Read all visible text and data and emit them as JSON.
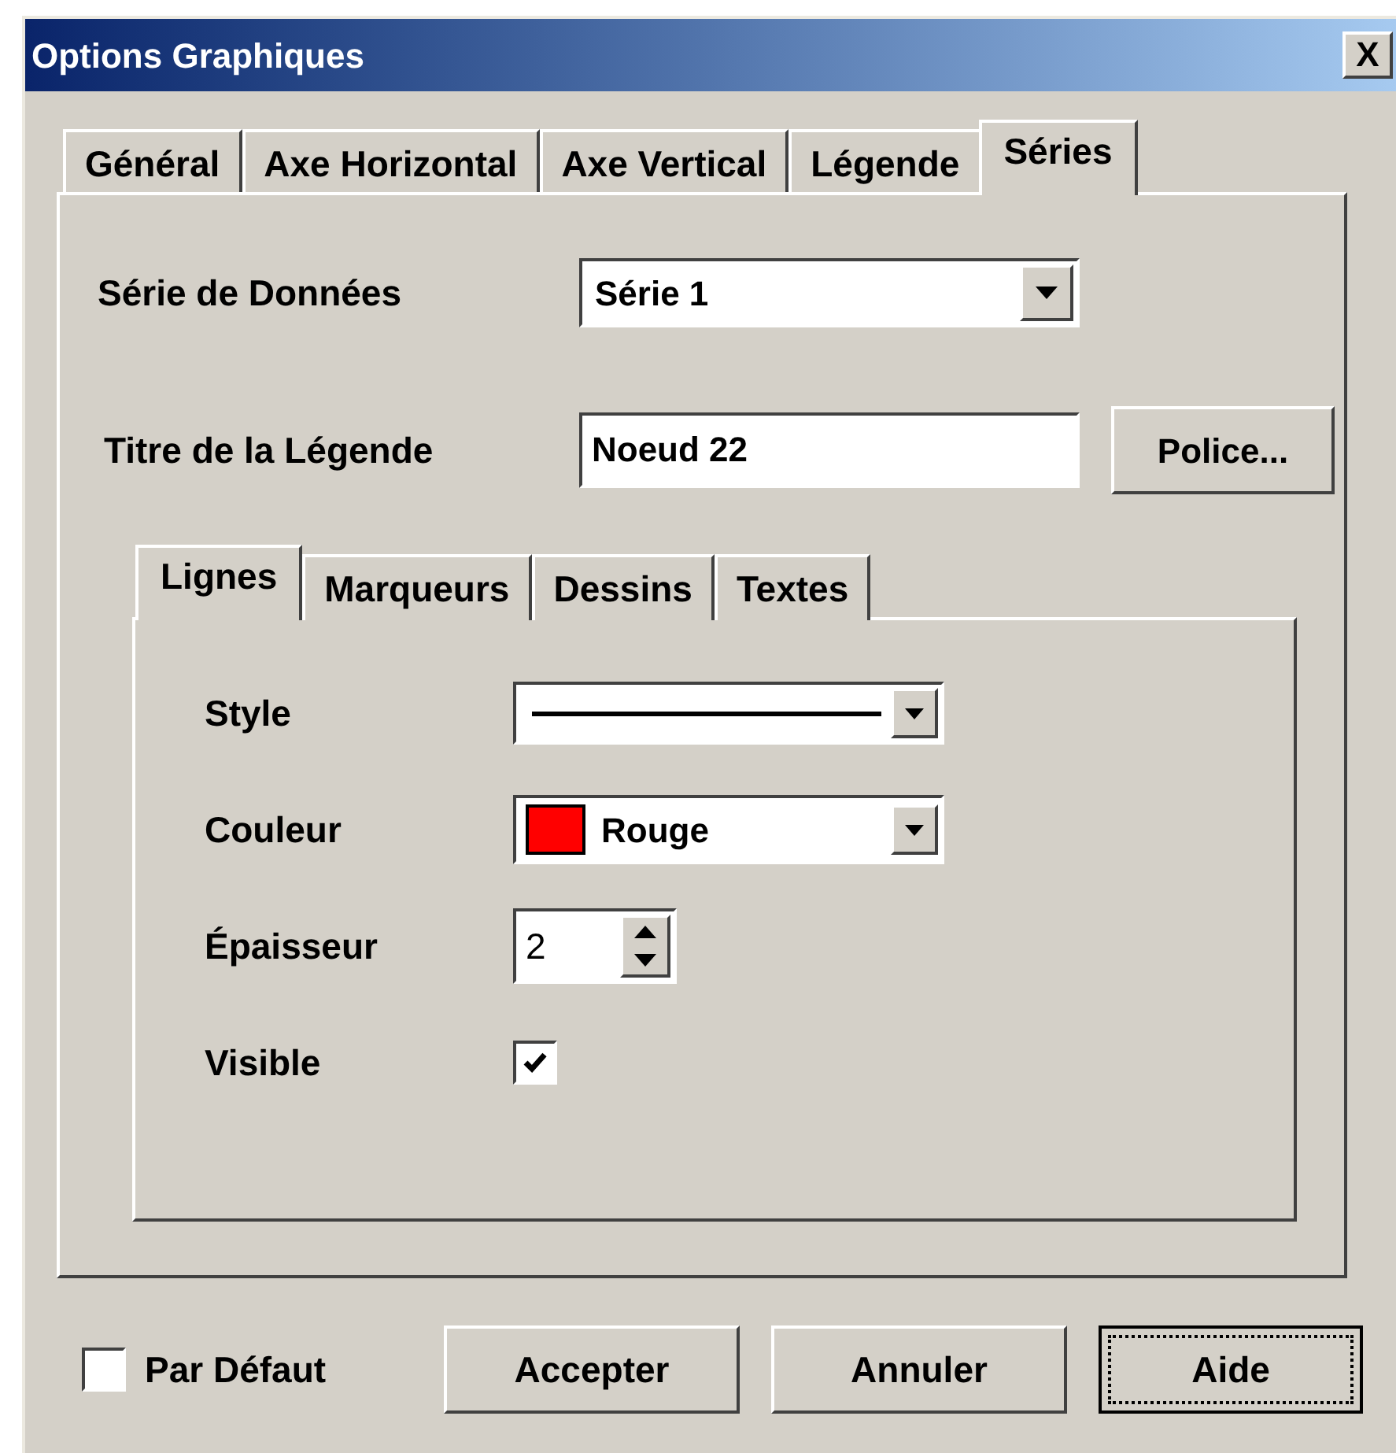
{
  "window": {
    "title": "Options Graphiques",
    "close": "X"
  },
  "tabs": [
    {
      "label": "Général",
      "selected": false
    },
    {
      "label": "Axe Horizontal",
      "selected": false
    },
    {
      "label": "Axe Vertical",
      "selected": false
    },
    {
      "label": "Légende",
      "selected": false
    },
    {
      "label": "Séries",
      "selected": true
    }
  ],
  "series_field": {
    "label": "Série de Données",
    "value": "Série 1"
  },
  "legend_title": {
    "label": "Titre de la Légende",
    "value": "Noeud 22",
    "button": "Police..."
  },
  "subtabs": [
    {
      "label": "Lignes",
      "selected": true
    },
    {
      "label": "Marqueurs",
      "selected": false
    },
    {
      "label": "Dessins",
      "selected": false
    },
    {
      "label": "Textes",
      "selected": false
    }
  ],
  "line_rows": [
    {
      "kind": "linestyle",
      "label": "Style"
    },
    {
      "kind": "color",
      "label": "Couleur",
      "value": "Rouge",
      "color": "#ff0000"
    },
    {
      "kind": "spin",
      "label": "Épaisseur",
      "value": "2"
    },
    {
      "kind": "check",
      "label": "Visible",
      "checked": true
    }
  ],
  "default_check": {
    "label": "Par Défaut",
    "checked": false
  },
  "buttons": [
    {
      "label": "Accepter",
      "default": false
    },
    {
      "label": "Annuler",
      "default": false
    },
    {
      "label": "Aide",
      "default": true
    }
  ]
}
